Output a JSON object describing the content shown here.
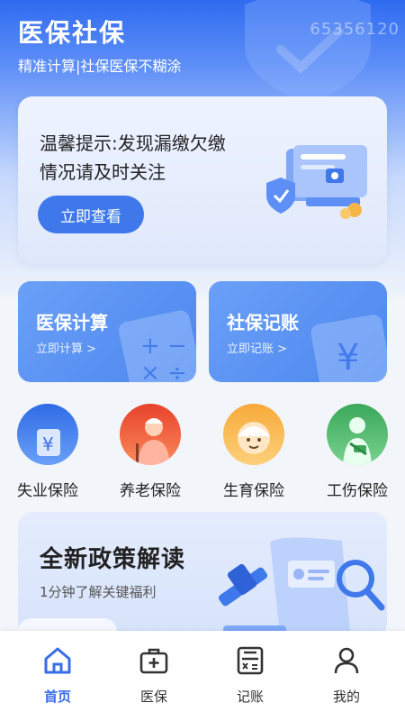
{
  "header": {
    "title": "医保社保",
    "subtitle": "精准计算|社保医保不糊涂",
    "watermark": "65356120"
  },
  "notice": {
    "text": "温馨提示:发现漏缴欠缴情况请及时关注",
    "button": "立即查看"
  },
  "features": [
    {
      "title": "医保计算",
      "sub": "立即计算 >"
    },
    {
      "title": "社保记账",
      "sub": "立即记账 >"
    }
  ],
  "insurance": [
    {
      "label": "失业保险",
      "icon": "yuan-wallet-icon",
      "color": "#3f7be8"
    },
    {
      "label": "养老保险",
      "icon": "elderly-person-icon",
      "color": "#f25a3a"
    },
    {
      "label": "生育保险",
      "icon": "baby-icon",
      "color": "#f7b046"
    },
    {
      "label": "工伤保险",
      "icon": "injured-worker-icon",
      "color": "#4cb96a"
    }
  ],
  "policy": {
    "title": "全新政策解读",
    "sub": "1分钟了解关键福利"
  },
  "bottom_nav": [
    {
      "label": "首页",
      "icon": "home-icon",
      "active": true
    },
    {
      "label": "医保",
      "icon": "medical-kit-icon",
      "active": false
    },
    {
      "label": "记账",
      "icon": "ledger-icon",
      "active": false
    },
    {
      "label": "我的",
      "icon": "profile-icon",
      "active": false
    }
  ],
  "colors": {
    "primary": "#3e78ea",
    "active_nav": "#3a6ee8"
  }
}
